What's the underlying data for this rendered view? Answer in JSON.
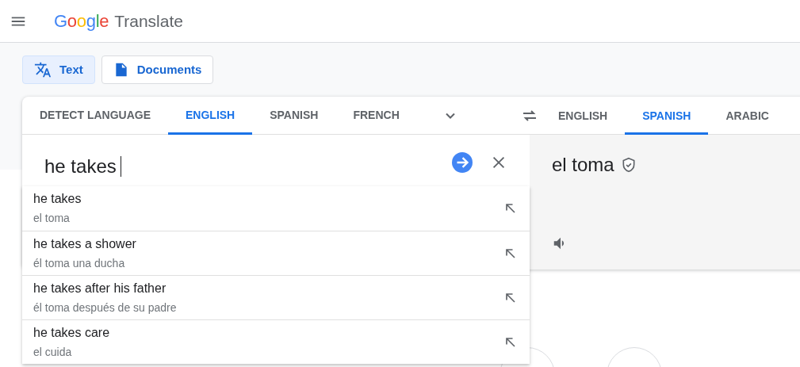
{
  "header": {
    "logo": "Google",
    "product": "Translate"
  },
  "modes": [
    {
      "label": "Text",
      "kind": "text",
      "selected": true
    },
    {
      "label": "Documents",
      "kind": "document",
      "selected": false
    }
  ],
  "source_tabs": [
    {
      "label": "DETECT LANGUAGE",
      "selected": false
    },
    {
      "label": "ENGLISH",
      "selected": true
    },
    {
      "label": "SPANISH",
      "selected": false
    },
    {
      "label": "FRENCH",
      "selected": false
    }
  ],
  "target_tabs": [
    {
      "label": "ENGLISH",
      "selected": false
    },
    {
      "label": "SPANISH",
      "selected": true
    },
    {
      "label": "ARABIC",
      "selected": false
    }
  ],
  "source_text": "he takes",
  "translation": "el toma",
  "suggestions": [
    {
      "text": "he takes",
      "translation": "el toma"
    },
    {
      "text": "he takes a shower",
      "translation": "él toma una ducha"
    },
    {
      "text": "he takes after his father",
      "translation": "él toma después de su padre"
    },
    {
      "text": "he takes care",
      "translation": "el cuida"
    }
  ]
}
